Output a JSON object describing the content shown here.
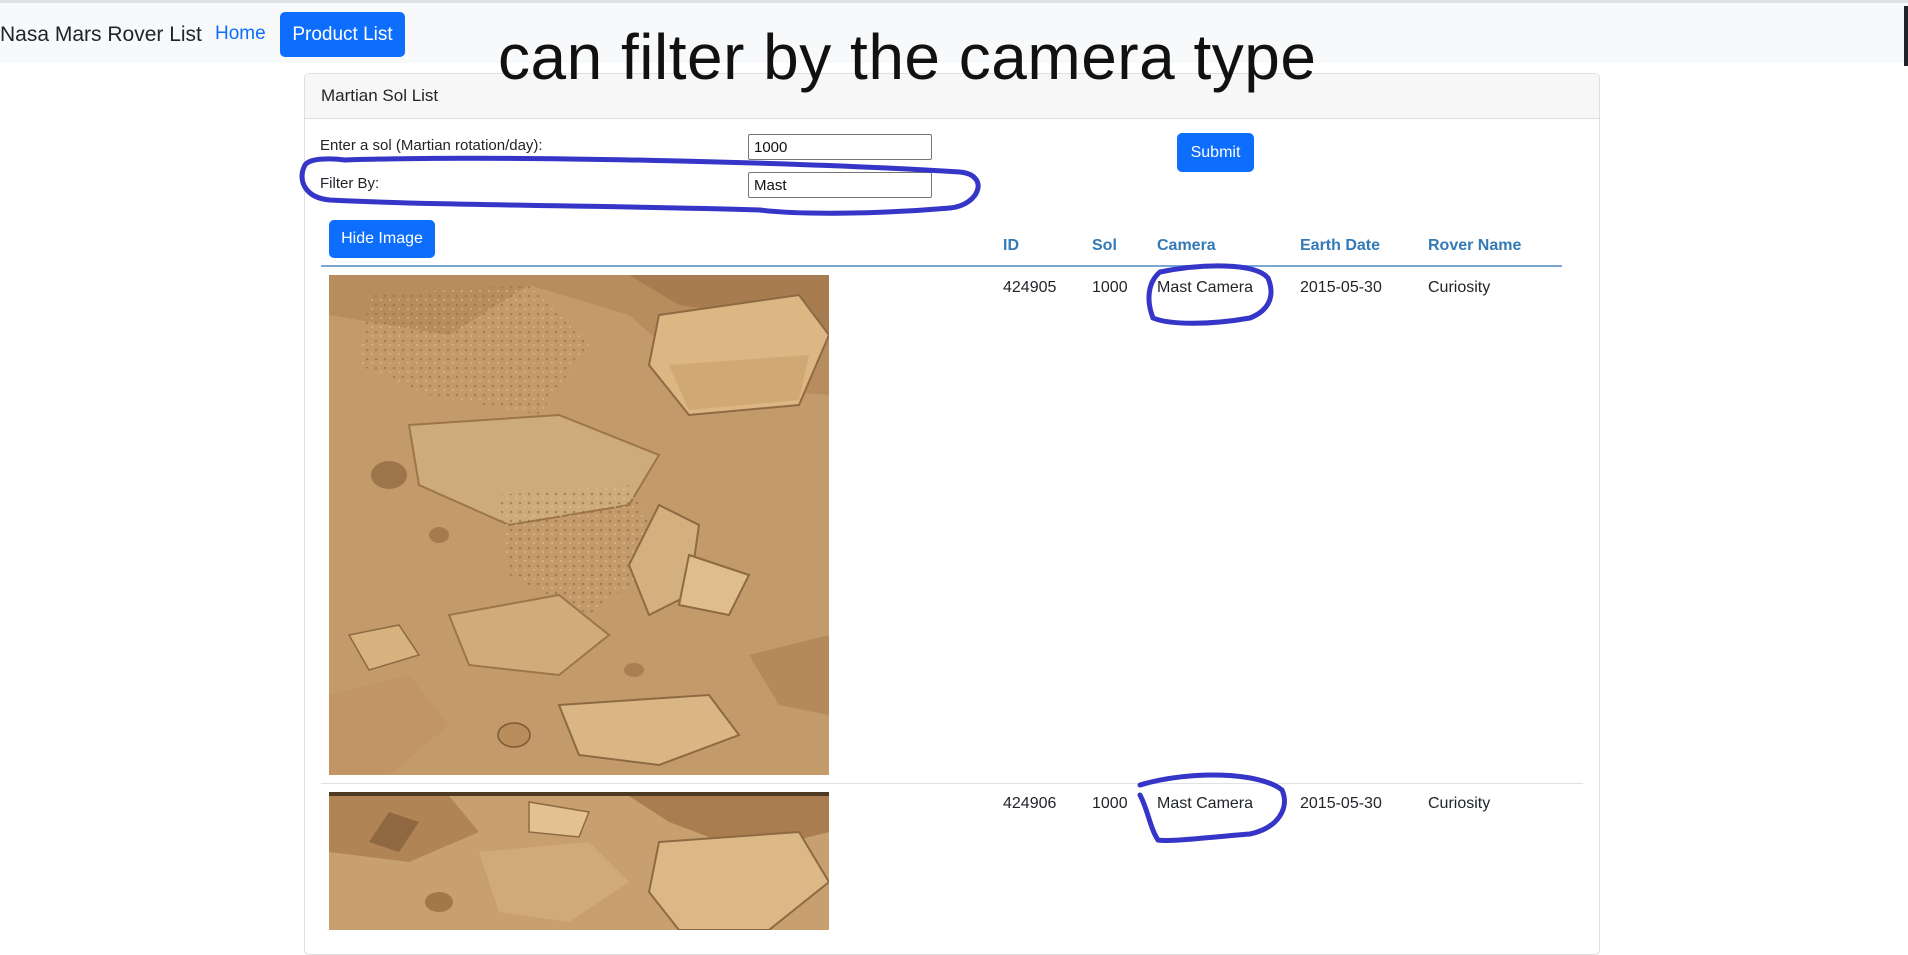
{
  "nav": {
    "brand": "Nasa Mars Rover List",
    "home": "Home",
    "product_list": "Product List"
  },
  "annotation": {
    "title": "can filter by the camera type"
  },
  "card": {
    "title": "Martian Sol List",
    "sol_label": "Enter a sol (Martian rotation/day):",
    "sol_value": "1000",
    "filter_label": "Filter By:",
    "filter_value": "Mast",
    "submit_label": "Submit",
    "hide_image_label": "Hide Image"
  },
  "table": {
    "headers": [
      "ID",
      "Sol",
      "Camera",
      "Earth Date",
      "Rover Name"
    ],
    "rows": [
      {
        "id": "424905",
        "sol": "1000",
        "camera": "Mast Camera",
        "earth_date": "2015-05-30",
        "rover": "Curiosity"
      },
      {
        "id": "424906",
        "sol": "1000",
        "camera": "Mast Camera",
        "earth_date": "2015-05-30",
        "rover": "Curiosity"
      }
    ]
  },
  "colors": {
    "primary": "#0d6efd",
    "header_link": "#337ab7",
    "annotation_ink": "#3535c8",
    "mars_sand": "#c49a6c"
  }
}
